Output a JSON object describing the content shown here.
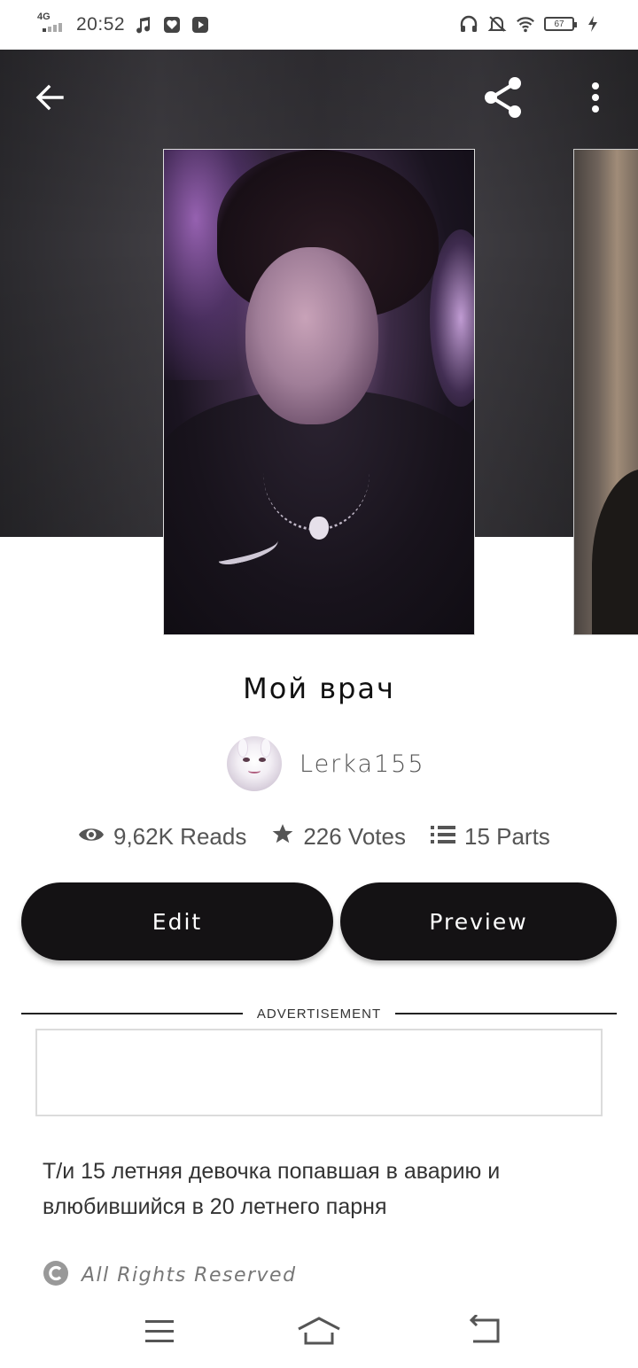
{
  "status_bar": {
    "network": "4G",
    "time": "20:52",
    "battery": "67",
    "left_icons": [
      "music-note-icon",
      "shield-heart-icon",
      "play-icon"
    ],
    "right_icons": [
      "headphones-icon",
      "bell-off-icon",
      "wifi-icon",
      "battery-icon",
      "charging-icon"
    ]
  },
  "toolbar": {
    "back_icon": "arrow-left-icon",
    "share_icon": "share-icon",
    "more_icon": "more-vertical-icon"
  },
  "story": {
    "title": "Мой врач",
    "author": "Lerka155",
    "reads": "9,62K Reads",
    "votes": "226 Votes",
    "parts": "15 Parts",
    "description": "Т/и 15 летняя девочка попавшая в аварию и влюбившийся в 20 летнего парня",
    "rights": "All Rights Reserved"
  },
  "actions": {
    "edit_label": "Edit",
    "preview_label": "Preview"
  },
  "advertisement": {
    "label": "ADVERTISEMENT"
  },
  "colors": {
    "button_bg": "#141214",
    "button_text": "#ffffff",
    "header_bg": "#343237",
    "text_secondary": "#555555"
  },
  "system_nav": [
    "menu-icon",
    "home-icon",
    "back-icon"
  ]
}
